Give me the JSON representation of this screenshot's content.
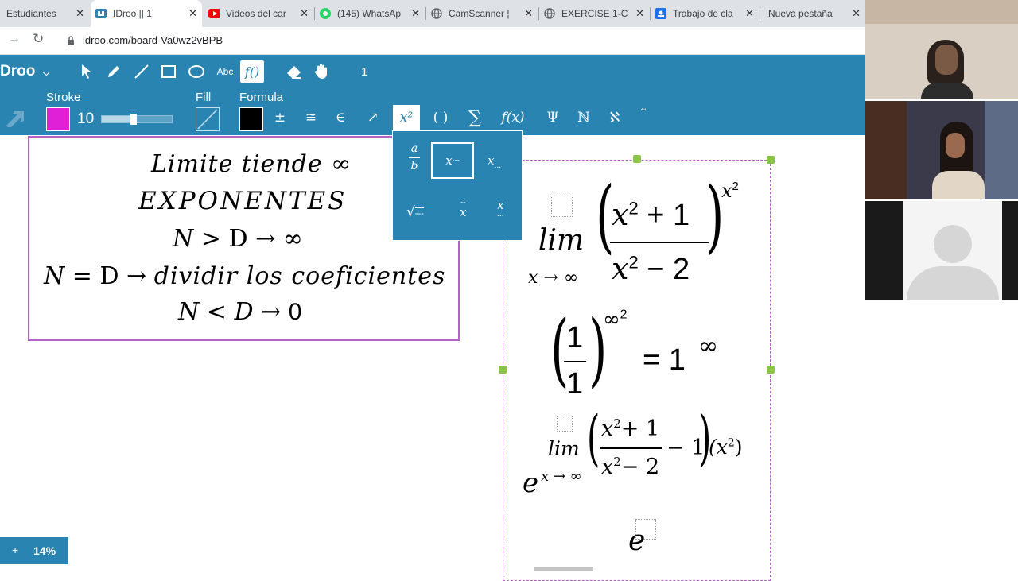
{
  "browser": {
    "tabs": [
      {
        "label": "Estudiantes",
        "icon": "none"
      },
      {
        "label": "IDroo || 1",
        "icon": "idroo-icon"
      },
      {
        "label": "Videos del car",
        "icon": "youtube-icon"
      },
      {
        "label": "(145) WhatsAp",
        "icon": "whatsapp-icon"
      },
      {
        "label": "CamScanner ¦",
        "icon": "globe-icon"
      },
      {
        "label": "EXERCISE 1-C",
        "icon": "globe-icon"
      },
      {
        "label": "Trabajo de cla",
        "icon": "classroom-icon"
      },
      {
        "label": "Nueva pestaña",
        "icon": "none"
      }
    ],
    "url": "idroo.com/board-Va0wz2vBPB"
  },
  "toolbar": {
    "brand": "Droo",
    "page_number": "1",
    "stroke_label": "Stroke",
    "stroke_value": "10",
    "stroke_level": 0.45,
    "fill_label": "Fill",
    "formula_label": "Formula",
    "abc_label": "Abc",
    "colors": {
      "stroke": "#e020d6",
      "formula": "#000000",
      "toolbar_bg": "#2a84b1"
    }
  },
  "notes_box": {
    "line1": "Limite tiende ∞",
    "line2": "EXPONENTES",
    "line3_n": "N",
    "line3_rest": "> D →  ∞",
    "line4_a": "N",
    "line4_b": "= D →",
    "line4_c": "dividir  los coeficientes",
    "line5_a": "N < D →",
    "line5_b": "0"
  },
  "formula_panel": {
    "items": [
      "fraction",
      "superscript",
      "subscript",
      "square-root",
      "overset",
      "underset"
    ]
  },
  "math": {
    "lim_label": "lim",
    "lim_sub": "x → ∞",
    "num": "x",
    "num_exp": "2",
    "num_tail": "+ 1",
    "den": "x",
    "den_exp": "2",
    "den_tail": "− 2",
    "outer_exp_base": "x",
    "outer_exp_pow": "2",
    "frac_one_num": "1",
    "frac_one_den": "1",
    "inf_exp": "∞",
    "inf_exp_pow": "2",
    "equals_one": "= 1",
    "equals_inf": "∞",
    "e_base": "e",
    "e_lim": "lim",
    "e_lim_sub": "x → ∞",
    "e_num_tail": "+ 1",
    "e_den_tail": "− 2",
    "minus_one": "− 1",
    "times_x2": "(x",
    "times_x2_end": ")",
    "e_last": "e"
  },
  "status": {
    "plus": "+",
    "zoom": "14%"
  }
}
